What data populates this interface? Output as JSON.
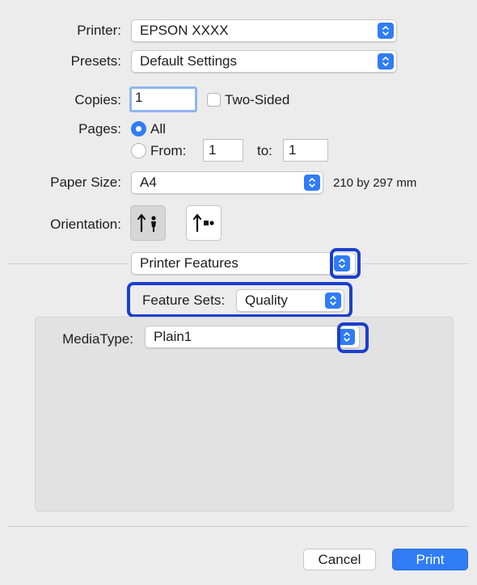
{
  "printer": {
    "label": "Printer:",
    "value": "EPSON XXXX"
  },
  "presets": {
    "label": "Presets:",
    "value": "Default Settings"
  },
  "copies": {
    "label": "Copies:",
    "value": "1",
    "two_sided_label": "Two-Sided",
    "two_sided_checked": false
  },
  "pages": {
    "label": "Pages:",
    "all_label": "All",
    "from_label": "From:",
    "from_value": "1",
    "to_label": "to:",
    "to_value": "1",
    "selected": "All"
  },
  "paper_size": {
    "label": "Paper Size:",
    "value": "A4",
    "dimensions": "210 by 297 mm"
  },
  "orientation": {
    "label": "Orientation:",
    "selected": "portrait",
    "options": [
      "portrait",
      "landscape"
    ]
  },
  "section_menu": {
    "value": "Printer Features"
  },
  "feature_sets": {
    "label": "Feature Sets:",
    "value": "Quality"
  },
  "media_type": {
    "label": "MediaType:",
    "value": "Plain1"
  },
  "buttons": {
    "cancel": "Cancel",
    "print": "Print"
  },
  "colors": {
    "accent": "#2f7cf6",
    "highlight_ring": "#1a3fcf",
    "background": "#ececec"
  }
}
